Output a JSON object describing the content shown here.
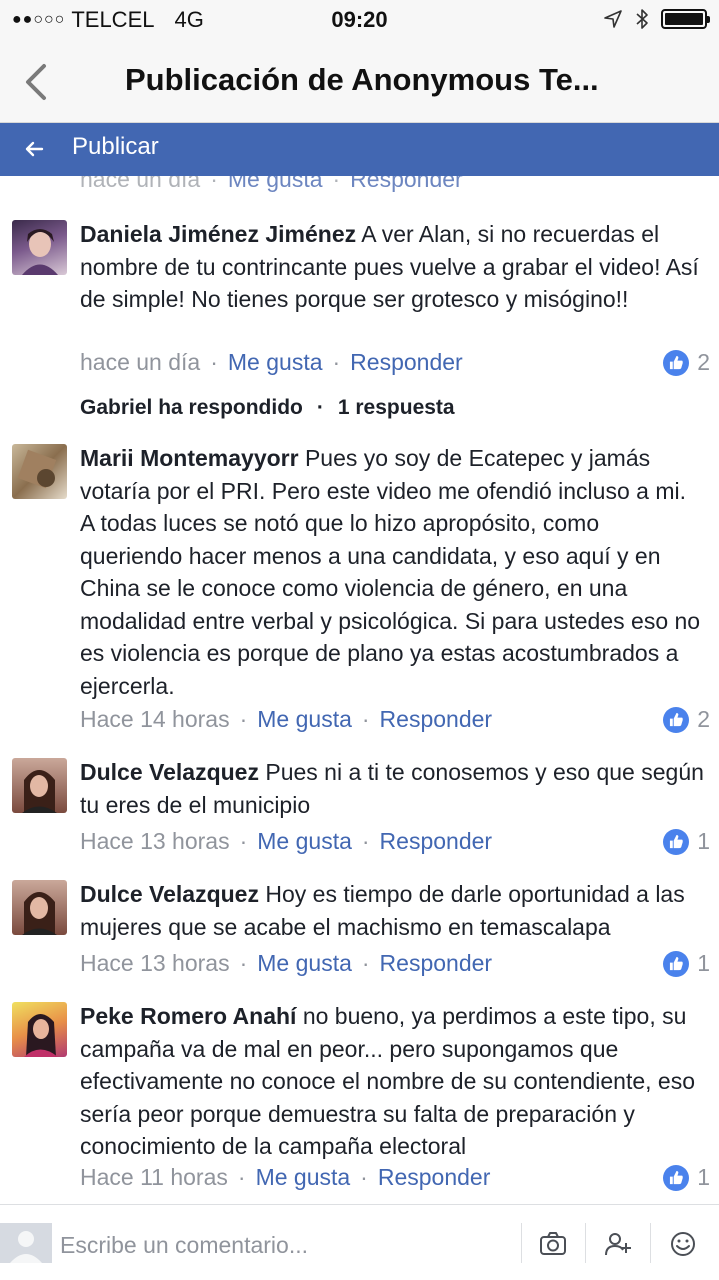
{
  "status_bar": {
    "signal_dots": "●●○○○",
    "carrier": "TELCEL",
    "network": "4G",
    "time": "09:20"
  },
  "nav": {
    "title": "Publicación de Anonymous Te..."
  },
  "publish_bar": {
    "label": "Publicar"
  },
  "partial_meta": {
    "time": "hace un día",
    "like": "Me gusta",
    "reply": "Responder"
  },
  "comments": [
    {
      "author": "Daniela Jiménez Jiménez",
      "text": "A ver Alan, si no recuerdas el nombre de tu contrincante pues vuelve a grabar el video! Así de simple! No tienes porque ser grotesco y misógino!!",
      "time": "hace un día",
      "like": "Me gusta",
      "reply": "Responder",
      "likes": "2"
    },
    {
      "author": "Marii Montemayyorr",
      "text": "Pues yo soy de Ecatepec y jamás votaría por el PRI. Pero este video me ofendió incluso a mi. A todas luces se notó que lo hizo apropósito, como queriendo hacer menos a una candidata, y eso aquí y en China se le conoce como violencia de género, en una modalidad entre verbal y psicológica. Si para ustedes eso no es violencia es porque de plano ya estas acostumbrados a ejercerla.",
      "time": "Hace 14 horas",
      "like": "Me gusta",
      "reply": "Responder",
      "likes": "2"
    },
    {
      "author": "Dulce Velazquez",
      "text": "Pues ni a ti te conosemos y eso que según tu eres de el municipio",
      "time": "Hace 13 horas",
      "like": "Me gusta",
      "reply": "Responder",
      "likes": "1"
    },
    {
      "author": "Dulce Velazquez",
      "text": "Hoy es tiempo de darle oportunidad a las mujeres que se acabe el machismo en temascalapa",
      "time": "Hace 13 horas",
      "like": "Me gusta",
      "reply": "Responder",
      "likes": "1"
    },
    {
      "author": "Peke Romero Anahí",
      "text": "no bueno, ya perdimos a este tipo, su campaña va de mal en peor... pero supongamos que efectivamente no conoce el nombre de su contendiente, eso sería peor porque demuestra su falta de preparación y conocimiento de la campaña electoral",
      "time": "Hace 11 horas",
      "like": "Me gusta",
      "reply": "Responder",
      "likes": "1"
    }
  ],
  "replies_row": {
    "replied": "Gabriel ha respondido",
    "count": "1 respuesta"
  },
  "composer": {
    "placeholder": "Escribe un comentario..."
  },
  "separator": "·",
  "colors": {
    "brand_blue": "#4267b2",
    "like_blue": "#4a82ec",
    "meta_gray": "#90949c"
  },
  "icons": {
    "back": "chevron-left-icon",
    "publish_back": "arrow-left-icon",
    "location": "location-arrow-icon",
    "bluetooth": "bluetooth-icon",
    "battery": "battery-icon",
    "like": "thumbs-up-icon",
    "camera": "camera-icon",
    "tag_friend": "add-person-icon",
    "emoji": "smiley-icon"
  }
}
